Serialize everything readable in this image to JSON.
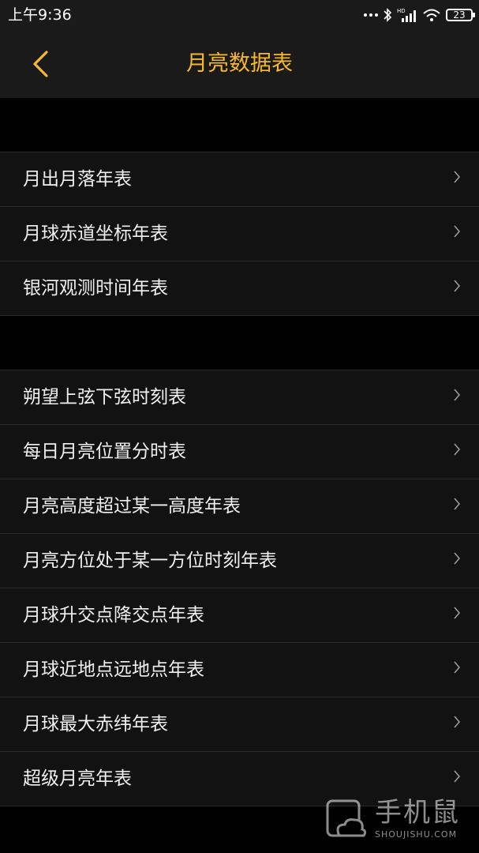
{
  "status": {
    "time": "上午9:36",
    "battery": "23",
    "network_label": "HD"
  },
  "header": {
    "title": "月亮数据表",
    "accent_color": "#f5b82e"
  },
  "sections": [
    {
      "items": [
        {
          "label": "月出月落年表"
        },
        {
          "label": "月球赤道坐标年表"
        },
        {
          "label": "银河观测时间年表"
        }
      ]
    },
    {
      "items": [
        {
          "label": "朔望上弦下弦时刻表"
        },
        {
          "label": "每日月亮位置分时表"
        },
        {
          "label": "月亮高度超过某一高度年表"
        },
        {
          "label": "月亮方位处于某一方位时刻年表"
        },
        {
          "label": "月球升交点降交点年表"
        },
        {
          "label": "月球近地点远地点年表"
        },
        {
          "label": "月球最大赤纬年表"
        },
        {
          "label": "超级月亮年表"
        }
      ]
    }
  ],
  "watermark": {
    "name": "手机鼠",
    "site": "SHOUJISHU.COM"
  }
}
